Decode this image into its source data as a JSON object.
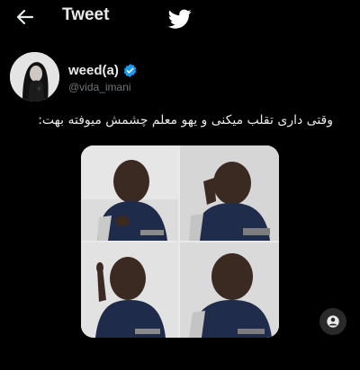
{
  "header": {
    "back_icon": "arrow-left-icon",
    "title": "Tweet",
    "logo_icon": "twitter-bird-icon"
  },
  "author": {
    "display_name": "weed(a)",
    "handle": "@vida_imani",
    "verified_icon": "verified-badge-icon",
    "verified_color": "#1d9bf0"
  },
  "tweet": {
    "text": "وقتی داری تقلب میکنی و یهو معلم چشمش میوفته بهت:"
  },
  "media": {
    "type": "image-grid",
    "panels": 4,
    "tag_icon": "person-tag-icon"
  },
  "colors": {
    "background": "#000000",
    "text": "#e7e9ea",
    "secondary": "#71767b"
  }
}
